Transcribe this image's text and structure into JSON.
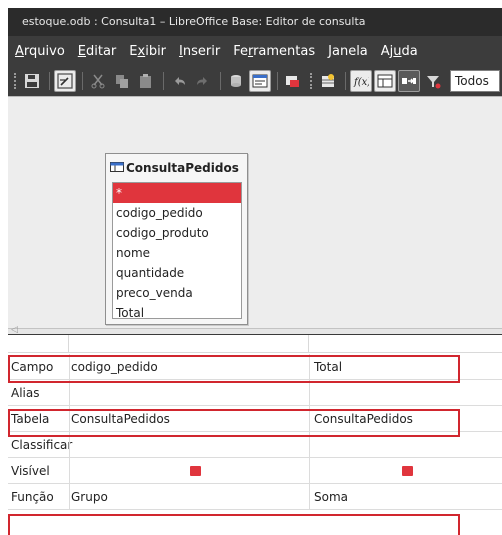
{
  "window": {
    "title": "estoque.odb : Consulta1 – LibreOffice Base: Editor de consulta"
  },
  "menubar": {
    "items": [
      {
        "label": "Arquivo"
      },
      {
        "label": "Editar"
      },
      {
        "label": "Exibir"
      },
      {
        "label": "Inserir"
      },
      {
        "label": "Ferramentas"
      },
      {
        "label": "Janela"
      },
      {
        "label": "Ajuda"
      }
    ]
  },
  "toolbar": {
    "limit_select_value": "Todos",
    "icons": [
      "save-icon",
      "edit-mode-icon",
      "cut-icon",
      "copy-icon",
      "paste-icon",
      "undo-icon",
      "redo-icon",
      "run-query-icon",
      "design-view-icon",
      "add-table-icon",
      "add-tables-icon",
      "functions-icon",
      "table-name-icon",
      "alias-icon",
      "distinct-values-icon"
    ]
  },
  "query_design": {
    "table": {
      "name": "ConsultaPedidos",
      "fields": [
        "*",
        "codigo_pedido",
        "codigo_produto",
        "nome",
        "quantidade",
        "preco_venda",
        "Total"
      ],
      "selected_index": 0
    }
  },
  "grid": {
    "rows": [
      {
        "label": "Campo",
        "col1": "codigo_pedido",
        "col2": "Total"
      },
      {
        "label": "Alias",
        "col1": "",
        "col2": ""
      },
      {
        "label": "Tabela",
        "col1": "ConsultaPedidos",
        "col2": "ConsultaPedidos"
      },
      {
        "label": "Classificar",
        "col1": "",
        "col2": ""
      },
      {
        "label": "Visível",
        "col1_checked": true,
        "col2_checked": true
      },
      {
        "label": "Função",
        "col1": "Grupo",
        "col2": "Soma"
      }
    ]
  },
  "colors": {
    "highlight": "#d1262e",
    "selection": "#e0353d",
    "titlebar": "#2b2b2b",
    "menubar": "#3c3c3c"
  }
}
